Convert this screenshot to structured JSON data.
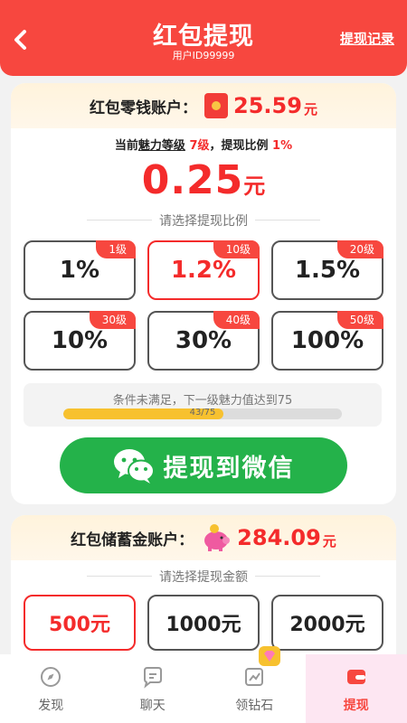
{
  "header": {
    "title": "红包提现",
    "user_id": "用户ID99999",
    "records_label": "提现记录"
  },
  "change_account": {
    "label": "红包零钱账户：",
    "amount": "25.59",
    "unit": "元",
    "level_prefix": "当前",
    "level_charm": "魅力等级",
    "level_value": "7级",
    "ratio_prefix": "，提现比例",
    "ratio_value": "1%",
    "withdraw_amount": "0.25",
    "withdraw_unit": "元",
    "select_ratio_title": "请选择提现比例",
    "options": [
      {
        "tag": "1级",
        "value": "1%"
      },
      {
        "tag": "10级",
        "value": "1.2%"
      },
      {
        "tag": "20级",
        "value": "1.5%"
      },
      {
        "tag": "30级",
        "value": "10%"
      },
      {
        "tag": "40级",
        "value": "30%"
      },
      {
        "tag": "50级",
        "value": "100%"
      }
    ],
    "selected_index": 1,
    "condition_text": "条件未满足，下一级魅力值达到75",
    "progress_text": "43/75",
    "progress_current": 43,
    "progress_total": 75,
    "wechat_button": "提现到微信"
  },
  "savings_account": {
    "label": "红包储蓄金账户：",
    "amount": "284.09",
    "unit": "元",
    "select_amount_title": "请选择提现金额",
    "amounts": [
      "500元",
      "1000元",
      "2000元"
    ],
    "selected_index": 0
  },
  "nav": [
    {
      "label": "发现",
      "icon": "compass-icon"
    },
    {
      "label": "聊天",
      "icon": "chat-icon"
    },
    {
      "label": "领钻石",
      "icon": "chart-icon"
    },
    {
      "label": "提现",
      "icon": "wallet-icon"
    }
  ],
  "colors": {
    "brand_red": "#f7473f",
    "wechat_green": "#24b24a",
    "progress_yellow": "#f7c12f"
  }
}
